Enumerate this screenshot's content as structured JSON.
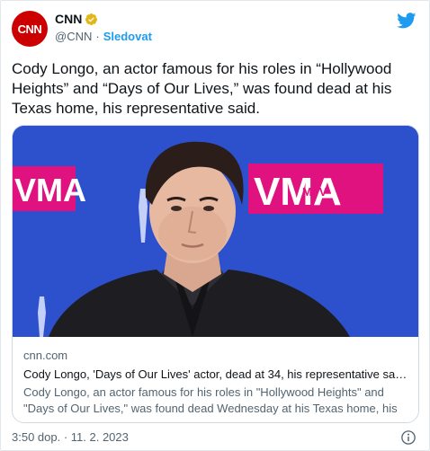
{
  "header": {
    "avatar_text": "CNN",
    "name": "CNN",
    "handle": "@CNN",
    "separator": "·",
    "follow_label": "Sledovat"
  },
  "tweet": {
    "text": "Cody Longo, an actor famous for his roles in “Hollywood Heights” and “Days of Our Lives,” was found dead at his Texas home, his representative said."
  },
  "card": {
    "domain": "cnn.com",
    "title": "Cody Longo, 'Days of Our Lives' actor, dead at 34, his representative say...",
    "description": "Cody Longo, an actor famous for his roles in \"Hollywood Heights\" and \"Days of Our Lives,\" was found dead Wednesday at his Texas home, his ...",
    "backdrop_left_text": "VMA",
    "backdrop_right_text": "VMA",
    "backdrop_logo_text": "MTV"
  },
  "footer": {
    "timestamp": "3:50 dop. · 11. 2. 2023"
  },
  "colors": {
    "brand_red": "#cc0000",
    "twitter_blue": "#1d9bf0",
    "verified_gold": "#e2b719",
    "backdrop_blue": "#2a4cc8",
    "backdrop_pink": "#e0127f"
  },
  "icons": {
    "verified": "verified-badge-icon",
    "twitter": "twitter-bird-icon",
    "info": "info-icon"
  }
}
